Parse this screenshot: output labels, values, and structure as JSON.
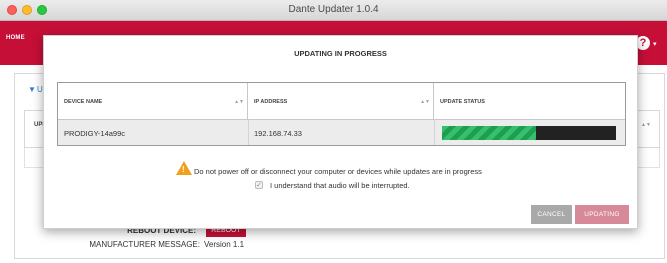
{
  "window": {
    "title": "Dante Updater 1.0.4"
  },
  "header": {
    "home_label": "HOME",
    "help_icon": "question-mark-icon",
    "help_glyph": "?",
    "caret": "▾"
  },
  "background": {
    "section_label": "U",
    "table_col_label": "UPD",
    "reboot_label": "REBOOT DEVICE:",
    "reboot_button": "REBOOT",
    "manufacturer_label": "MANUFACTURER MESSAGE:",
    "manufacturer_value": "Version 1.1"
  },
  "modal": {
    "title": "UPDATING IN PROGRESS",
    "columns": [
      "DEVICE NAME",
      "IP ADDRESS",
      "UPDATE STATUS"
    ],
    "rows": [
      {
        "device_name": "PRODIGY-14a99c",
        "ip_address": "192.168.74.33",
        "update_progress": 0.54
      }
    ],
    "warning_text": "Do not power off or disconnect your computer or devices while updates are in progress",
    "checkbox_label": "I understand that audio will be interrupted.",
    "checkbox_checked": true,
    "cancel_label": "CANCEL",
    "updating_label": "UPDATING"
  },
  "colors": {
    "brand": "#c50f37",
    "progress": "#37c06b",
    "warning": "#f1a01c"
  }
}
